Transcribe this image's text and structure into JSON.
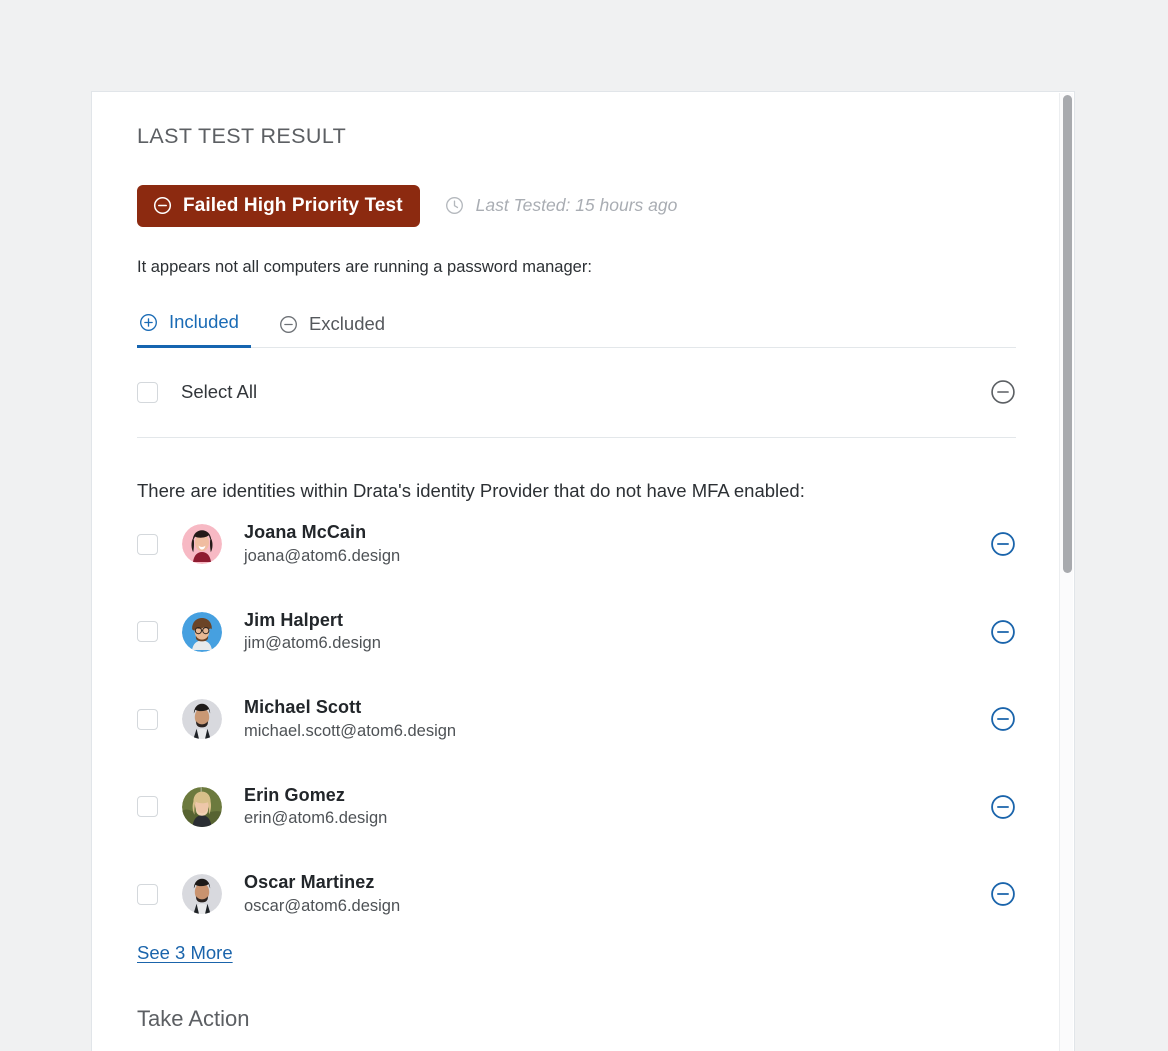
{
  "section": {
    "title": "LAST TEST RESULT",
    "status_badge": {
      "label": "Failed High Priority Test",
      "icon": "minus-circle-icon",
      "color": "#8c2a10",
      "text_color": "#ffffff"
    },
    "last_tested": {
      "icon": "clock-icon",
      "text": "Last Tested: 15 hours ago"
    },
    "description": "It appears not all computers are running a password manager:"
  },
  "tabs": [
    {
      "label": "Included",
      "icon": "plus-circle-icon",
      "active": true
    },
    {
      "label": "Excluded",
      "icon": "minus-circle-icon",
      "active": false
    }
  ],
  "select_all": {
    "label": "Select All",
    "checked": false,
    "action_icon": "minus-circle-icon",
    "action_color": "#5b5f63"
  },
  "list": {
    "intro": "There are identities within Drata's identity Provider that do not have MFA enabled:",
    "action_icon": "minus-circle-icon",
    "action_color": "#1a64ab",
    "people": [
      {
        "name": "Joana McCain",
        "email": "joana@atom6.design",
        "checked": false,
        "avatar": {
          "bg": "#f7b9c4",
          "hair": "#231a18",
          "skin": "#f0bda1",
          "shirt": "#8e1b30"
        }
      },
      {
        "name": "Jim Halpert",
        "email": "jim@atom6.design",
        "checked": false,
        "avatar": {
          "bg": "#46a0e0",
          "hair": "#6b4427",
          "skin": "#e8b894",
          "shirt": "#e8eaec"
        }
      },
      {
        "name": "Michael Scott",
        "email": "michael.scott@atom6.design",
        "checked": false,
        "avatar": {
          "bg": "#d8d9de",
          "hair": "#1d1a19",
          "skin": "#c99874",
          "shirt": "#e9eaec"
        }
      },
      {
        "name": "Erin Gomez",
        "email": "erin@atom6.design",
        "checked": false,
        "avatar": {
          "bg": "#6c7a3e",
          "hair": "#d8c08a",
          "skin": "#eec7a9",
          "shirt": "#2b2e33"
        }
      },
      {
        "name": "Oscar Martinez",
        "email": "oscar@atom6.design",
        "checked": false,
        "avatar": {
          "bg": "#d8d9de",
          "hair": "#1c1917",
          "skin": "#c9936f",
          "shirt": "#e9eaec"
        }
      }
    ],
    "see_more_label": "See 3 More"
  },
  "take_action": {
    "title": "Take Action"
  }
}
